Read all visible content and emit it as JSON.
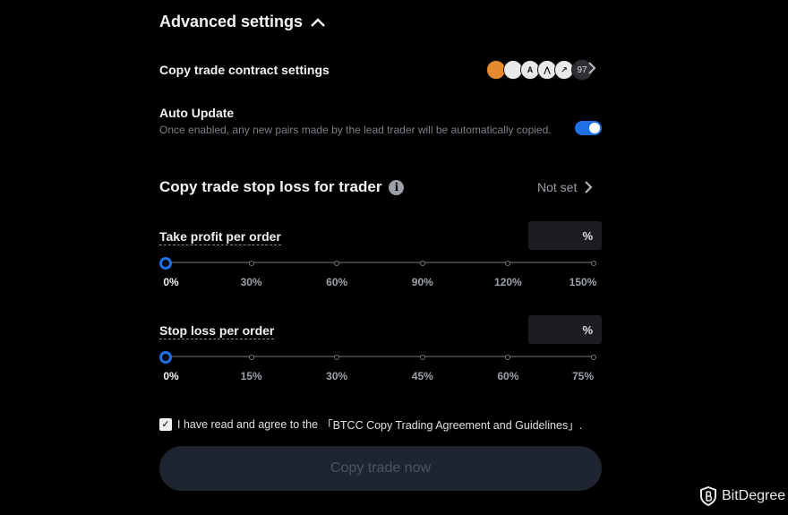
{
  "advanced": {
    "title": "Advanced settings"
  },
  "contract": {
    "label": "Copy trade contract settings",
    "more_count": "97",
    "coins": [
      {
        "name": "shiba-icon",
        "color": "#e58a2e",
        "glyph": ""
      },
      {
        "name": "apple-icon",
        "color": "#e9e9e9",
        "glyph": ""
      },
      {
        "name": "coin-a-icon",
        "color": "#e9e9e9",
        "glyph": "A"
      },
      {
        "name": "coin-arrow-icon",
        "color": "#e9e9e9",
        "glyph": "⋀"
      },
      {
        "name": "coin-green-icon",
        "color": "#e9e9e9",
        "glyph": "↗"
      }
    ]
  },
  "auto_update": {
    "label": "Auto Update",
    "desc": "Once enabled, any new pairs made by the lead trader will be automatically copied.",
    "enabled": true
  },
  "stop_loss_trader": {
    "label": "Copy trade stop loss for trader",
    "value": "Not set"
  },
  "take_profit": {
    "label": "Take profit per order",
    "unit": "%",
    "value": "0%",
    "ticks": [
      "0%",
      "30%",
      "60%",
      "90%",
      "120%",
      "150%"
    ]
  },
  "stop_loss": {
    "label": "Stop loss per order",
    "unit": "%",
    "value": "0%",
    "ticks": [
      "0%",
      "15%",
      "30%",
      "45%",
      "60%",
      "75%"
    ]
  },
  "agreement": {
    "prefix": "I have read and agree to the",
    "link": "「BTCC Copy Trading Agreement and Guidelines」.",
    "checked": true
  },
  "submit": {
    "label": "Copy trade now"
  },
  "watermark": {
    "brand": "BitDegree"
  },
  "colors": {
    "accent": "#1f6fe5",
    "background": "#000000",
    "button_bg": "#1f2530"
  }
}
